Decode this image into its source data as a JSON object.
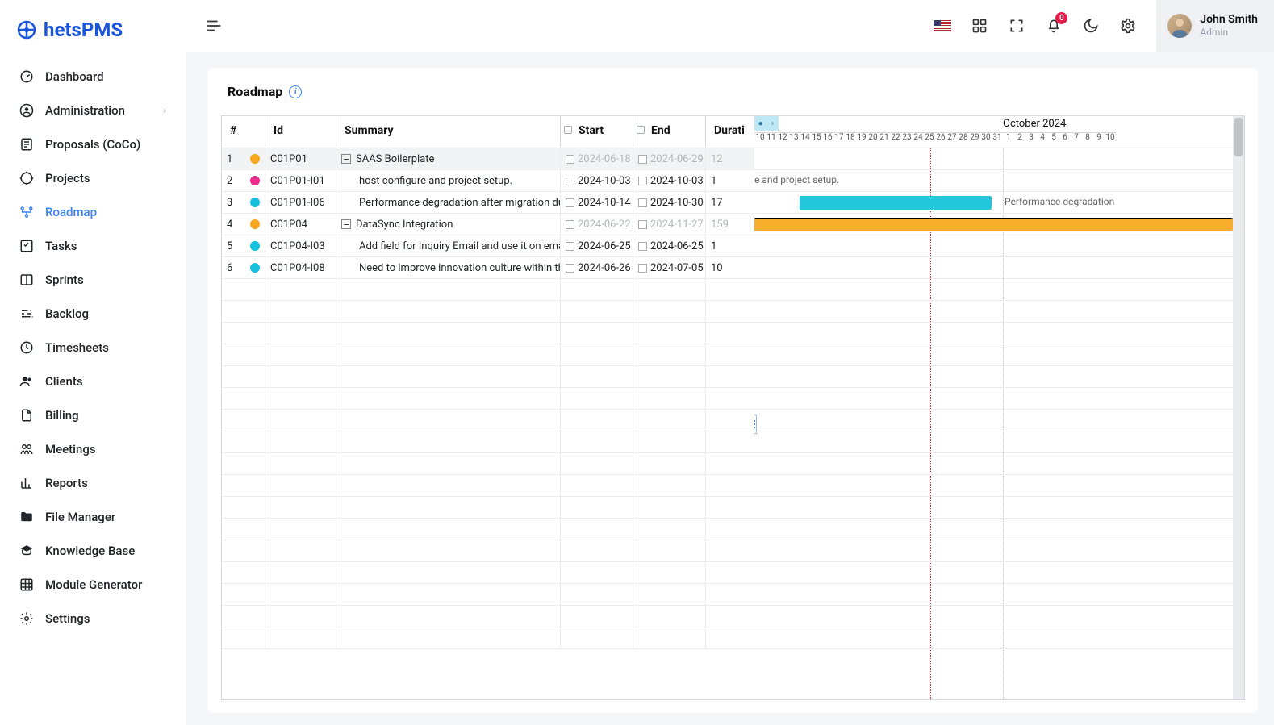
{
  "brand": {
    "name": "hetsPMS"
  },
  "user": {
    "name": "John Smith",
    "role": "Admin",
    "notif_count": "0"
  },
  "sidebar": {
    "items": [
      {
        "label": "Dashboard"
      },
      {
        "label": "Administration",
        "has_children": true
      },
      {
        "label": "Proposals (CoCo)"
      },
      {
        "label": "Projects"
      },
      {
        "label": "Roadmap",
        "active": true
      },
      {
        "label": "Tasks"
      },
      {
        "label": "Sprints"
      },
      {
        "label": "Backlog"
      },
      {
        "label": "Timesheets"
      },
      {
        "label": "Clients"
      },
      {
        "label": "Billing"
      },
      {
        "label": "Meetings"
      },
      {
        "label": "Reports"
      },
      {
        "label": "File Manager"
      },
      {
        "label": "Knowledge Base"
      },
      {
        "label": "Module Generator"
      },
      {
        "label": "Settings"
      }
    ]
  },
  "page": {
    "title": "Roadmap"
  },
  "columns": {
    "num": "#",
    "id": "Id",
    "summary": "Summary",
    "start": "Start",
    "end": "End",
    "duration": "Durati"
  },
  "rows": [
    {
      "n": "1",
      "color": "orange",
      "id": "C01P01",
      "summary": "SAAS Boilerplate",
      "start": "2024-06-18",
      "end": "2024-06-29",
      "dur": "12",
      "parent": true,
      "dim": true
    },
    {
      "n": "2",
      "color": "pink",
      "id": "C01P01-I01",
      "summary": "host configure and project setup.",
      "start": "2024-10-03",
      "end": "2024-10-03",
      "dur": "1",
      "indent": true
    },
    {
      "n": "3",
      "color": "cyan",
      "id": "C01P01-I06",
      "summary": "Performance degradation after migration du",
      "start": "2024-10-14",
      "end": "2024-10-30",
      "dur": "17",
      "indent": true
    },
    {
      "n": "4",
      "color": "orange",
      "id": "C01P04",
      "summary": "DataSync Integration",
      "start": "2024-06-22",
      "end": "2024-11-27",
      "dur": "159",
      "parent": true,
      "dim": true
    },
    {
      "n": "5",
      "color": "cyan",
      "id": "C01P04-I03",
      "summary": "Add field for Inquiry Email and use it on ema",
      "start": "2024-06-25",
      "end": "2024-06-25",
      "dur": "1",
      "indent": true
    },
    {
      "n": "6",
      "color": "cyan",
      "id": "C01P04-I08",
      "summary": "Need to improve innovation culture within th",
      "start": "2024-06-26",
      "end": "2024-07-05",
      "dur": "10",
      "indent": true
    }
  ],
  "timeline": {
    "month_label": "October 2024",
    "days": [
      "10",
      "11",
      "12",
      "13",
      "14",
      "15",
      "16",
      "17",
      "18",
      "19",
      "20",
      "21",
      "22",
      "23",
      "24",
      "25",
      "26",
      "27",
      "28",
      "29",
      "30",
      "31",
      "1",
      "2",
      "3",
      "4",
      "5",
      "6",
      "7",
      "8",
      "9",
      "10"
    ],
    "bar_labels": {
      "row2": "e and project setup.",
      "row3": "Performance degradation"
    }
  }
}
